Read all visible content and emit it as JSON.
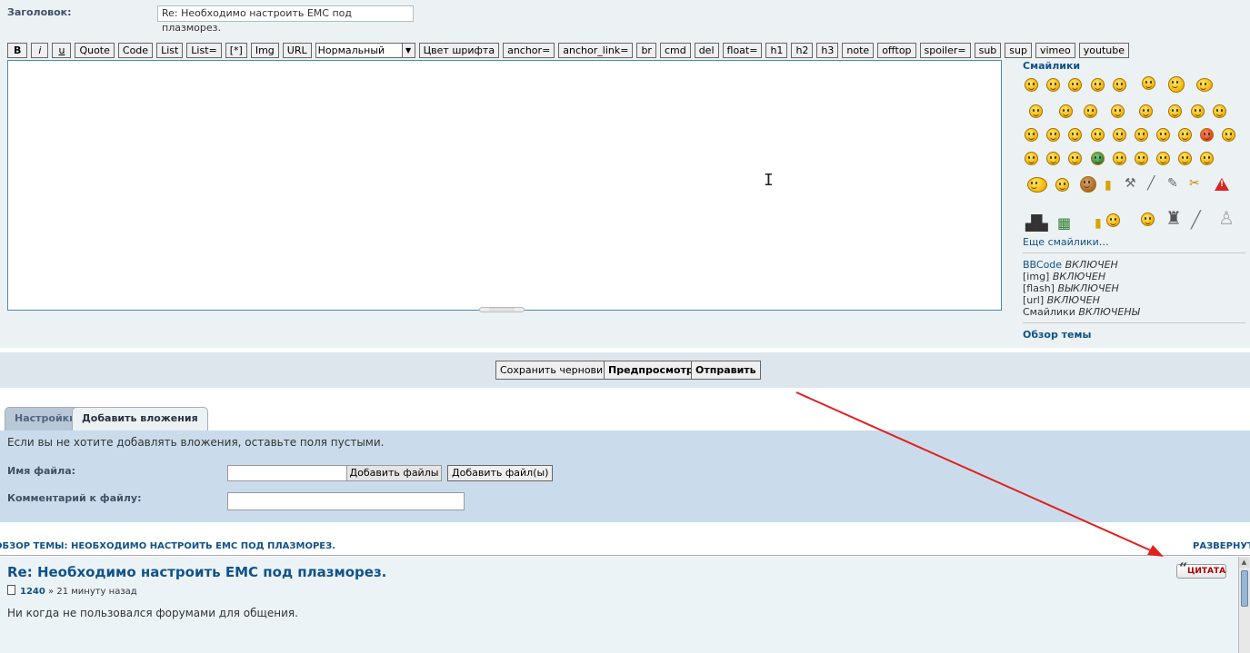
{
  "subject": {
    "label": "Заголовок:",
    "value": "Re: Необходимо настроить EMC под плазморез."
  },
  "toolbar": {
    "buttons": [
      "B",
      "i",
      "u",
      "Quote",
      "Code",
      "List",
      "List=",
      "[*]",
      "Img",
      "URL"
    ],
    "font_size_selected": "Нормальный",
    "extra_buttons": [
      "Цвет шрифта",
      "anchor=",
      "anchor_link=",
      "br",
      "cmd",
      "del",
      "float=",
      "h1",
      "h2",
      "h3",
      "note",
      "offtop",
      "spoiler=",
      "sub",
      "sup",
      "vimeo",
      "youtube"
    ]
  },
  "sidebar": {
    "smilies_title": "Смайлики",
    "more_smilies": "Еще смайлики…",
    "options": [
      {
        "name": "BBCode",
        "state": "ВКЛЮЧЕН"
      },
      {
        "name": "[img]",
        "state": "ВКЛЮЧЕН"
      },
      {
        "name": "[flash]",
        "state": "ВЫКЛЮЧЕН"
      },
      {
        "name": "[url]",
        "state": "ВКЛЮЧЕН"
      },
      {
        "name": "Смайлики",
        "state": "ВКЛЮЧЕНЫ"
      }
    ],
    "topic_review": "Обзор темы"
  },
  "submit": {
    "save_draft": "Сохранить черновик",
    "preview": "Предпросмотр",
    "send": "Отправить"
  },
  "tabs": [
    {
      "label": "Настройки",
      "active": false
    },
    {
      "label": "Добавить вложения",
      "active": true
    }
  ],
  "attachments": {
    "note": "Если вы не хотите добавлять вложения, оставьте поля пустыми.",
    "filename_label": "Имя файла:",
    "browse_button": "Добавить файлы",
    "add_button": "Добавить файл(ы)",
    "comment_label": "Комментарий к файлу:"
  },
  "review": {
    "title": "ОБЗОР ТЕМЫ: НЕОБХОДИМО НАСТРОИТЬ EMC ПОД ПЛАЗМОРЕЗ.",
    "expand": "РАЗВЕРНУТЬ"
  },
  "post": {
    "title": "Re: Необходимо настроить EMC под плазморез.",
    "author": "1240",
    "time": "» 21 минуту назад",
    "body": "Ни когда не пользовался форумами для общения.",
    "quote_label": "ЦИТАТА"
  },
  "colors": {
    "link": "#105289",
    "annotation_arrow": "#e02020"
  }
}
